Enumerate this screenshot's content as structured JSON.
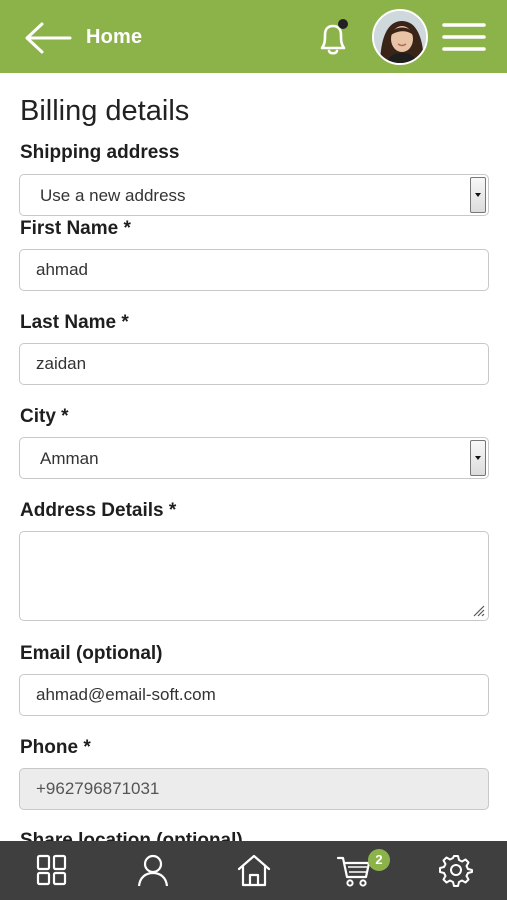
{
  "header": {
    "back_label": "Home",
    "colors": {
      "brand": "#8cb34a",
      "badge_dot": "#222222"
    }
  },
  "form": {
    "title": "Billing details",
    "shipping": {
      "label": "Shipping address",
      "selected": "Use a new address"
    },
    "first_name": {
      "label": "First Name *",
      "value": "ahmad"
    },
    "last_name": {
      "label": "Last Name *",
      "value": "zaidan"
    },
    "city": {
      "label": "City *",
      "selected": "Amman"
    },
    "address_details": {
      "label": "Address Details *",
      "value": ""
    },
    "email": {
      "label": "Email (optional)",
      "value": "ahmad@email-soft.com"
    },
    "phone": {
      "label": "Phone *",
      "value": "+962796871031"
    },
    "share_location": {
      "label": "Share location (optional)"
    }
  },
  "bottom_nav": {
    "items": [
      "grid-icon",
      "user-icon",
      "home-icon",
      "cart-icon",
      "gear-icon"
    ],
    "cart_count": "2",
    "colors": {
      "bar": "#3f3f3f",
      "badge": "#8cb34a"
    }
  }
}
